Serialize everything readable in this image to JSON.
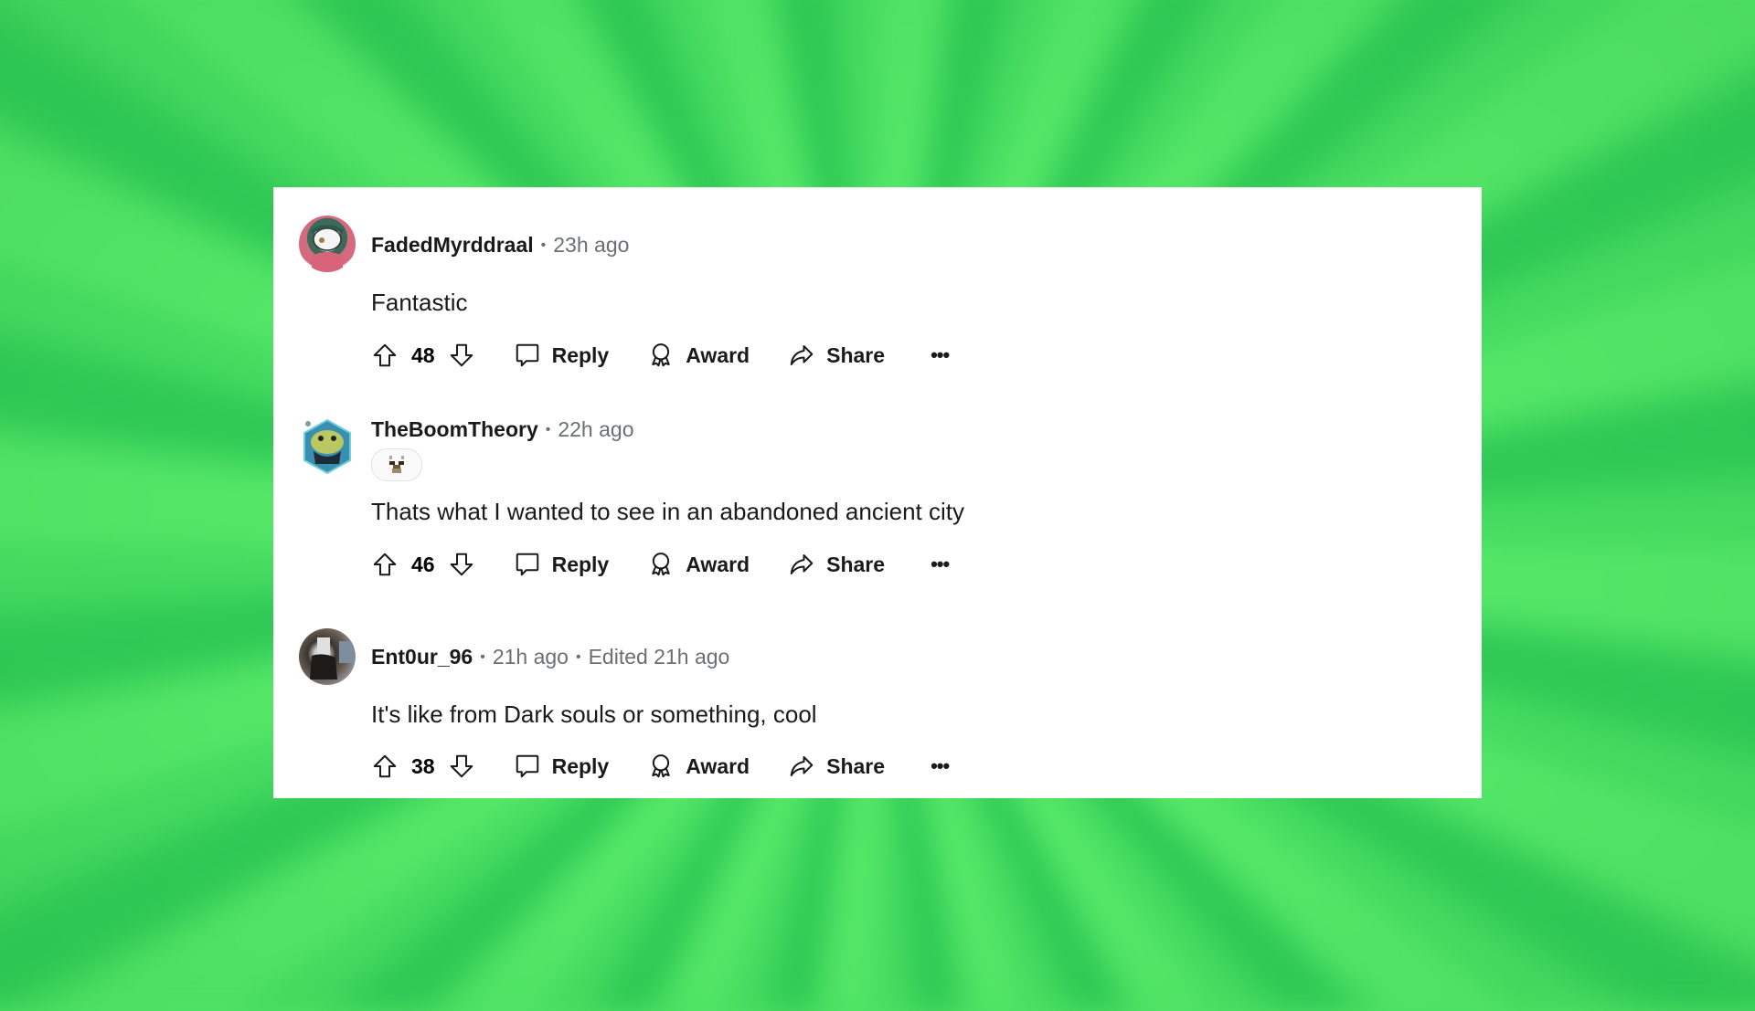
{
  "comments": [
    {
      "username": "FadedMyrddraal",
      "time": "23h ago",
      "edited": null,
      "text": "Fantastic",
      "votes": "48",
      "avatar": "mask-creature-avatar",
      "flair": false
    },
    {
      "username": "TheBoomTheory",
      "time": "22h ago",
      "edited": null,
      "text": "Thats what I wanted to see in an abandoned ancient city",
      "votes": "46",
      "avatar": "hexagon-frog-avatar",
      "flair": true,
      "flair_icon": "pixel-llama-icon"
    },
    {
      "username": "Ent0ur_96",
      "time": "21h ago",
      "edited": "Edited 21h ago",
      "text": "It's like from Dark souls or something, cool",
      "votes": "38",
      "avatar": "photo-avatar",
      "flair": false
    }
  ],
  "actions": {
    "reply": "Reply",
    "award": "Award",
    "share": "Share",
    "more": "•••"
  },
  "colors": {
    "background": "#4fe264",
    "card": "#ffffff",
    "text": "#1a1a1b",
    "meta": "#6a6f73"
  }
}
